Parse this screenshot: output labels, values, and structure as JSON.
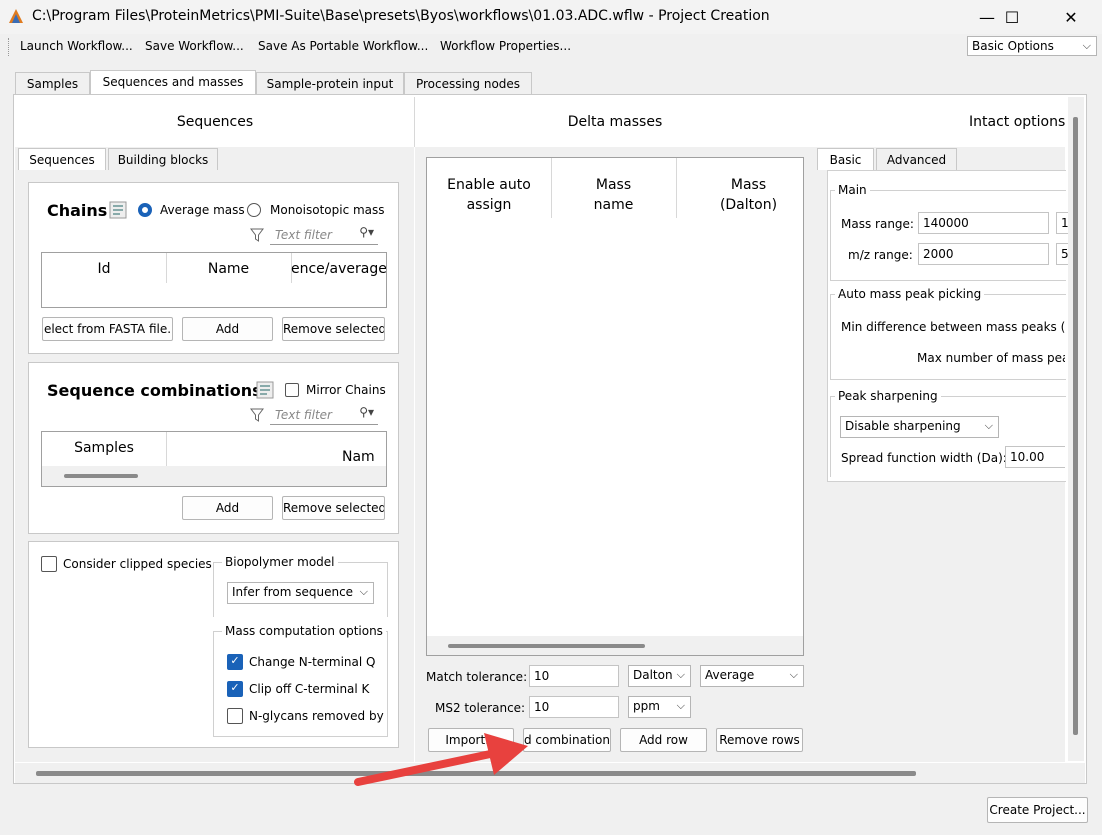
{
  "window": {
    "title": "C:\\Program Files\\ProteinMetrics\\PMI-Suite\\Base\\presets\\Byos\\workflows\\01.03.ADC.wflw - Project Creation",
    "minimize": "—",
    "maximize": "☐",
    "close": "✕"
  },
  "toolbar": {
    "launch": "Launch Workflow...",
    "save": "Save Workflow...",
    "save_portable": "Save As Portable Workflow...",
    "properties": "Workflow Properties...",
    "options_select": "Basic Options"
  },
  "tabs": [
    "Samples",
    "Sequences and masses",
    "Sample-protein input",
    "Processing nodes"
  ],
  "sequences": {
    "header": "Sequences",
    "subtabs": [
      "Sequences",
      "Building blocks"
    ],
    "chains": {
      "title": "Chains",
      "radio_average": "Average mass",
      "radio_mono": "Monoisotopic mass",
      "filter_placeholder": "Text filter",
      "columns": [
        "Id",
        "Name",
        "ence/average"
      ],
      "btn_fasta": "elect from FASTA file.",
      "btn_add": "Add",
      "btn_remove": "Remove selected"
    },
    "combinations": {
      "title": "Sequence combinations",
      "mirror": "Mirror Chains",
      "filter_placeholder": "Text filter",
      "columns": [
        "Samples",
        "Nam"
      ],
      "btn_add": "Add",
      "btn_remove": "Remove selected"
    },
    "options": {
      "clipped": "Consider clipped species",
      "biopolymer_label": "Biopolymer model",
      "biopolymer_value": "Infer from sequence",
      "mass_comp_label": "Mass computation options",
      "opt1": "Change N-terminal Q",
      "opt2": "Clip off C-terminal K",
      "opt3": "N-glycans removed by"
    }
  },
  "delta": {
    "header": "Delta masses",
    "columns": [
      "Enable auto assign",
      "Mass name",
      "Mass (Dalton)"
    ],
    "match_label": "Match tolerance:",
    "match_value": "10",
    "match_unit": "Dalton",
    "match_type": "Average",
    "ms2_label": "MS2 tolerance:",
    "ms2_value": "10",
    "ms2_unit": "ppm",
    "btn_import": "Import...",
    "btn_comb": "d combination:",
    "btn_addrow": "Add row",
    "btn_remove": "Remove rows"
  },
  "intact": {
    "header": "Intact options",
    "subtabs": [
      "Basic",
      "Advanced"
    ],
    "main_label": "Main",
    "mass_range_label": "Mass range:",
    "mass_range_min": "140000",
    "mass_range_max": "1",
    "mz_label": "m/z range:",
    "mz_min": "2000",
    "mz_max": "5",
    "auto_label": "Auto mass peak picking",
    "min_diff": "Min difference between mass peaks (Da",
    "max_num": "Max number of mass peal",
    "sharpen_label": "Peak sharpening",
    "sharpen_value": "Disable sharpening",
    "spread_label": "Spread function width (Da):",
    "spread_value": "10.00"
  },
  "footer": {
    "create": "Create Project..."
  }
}
